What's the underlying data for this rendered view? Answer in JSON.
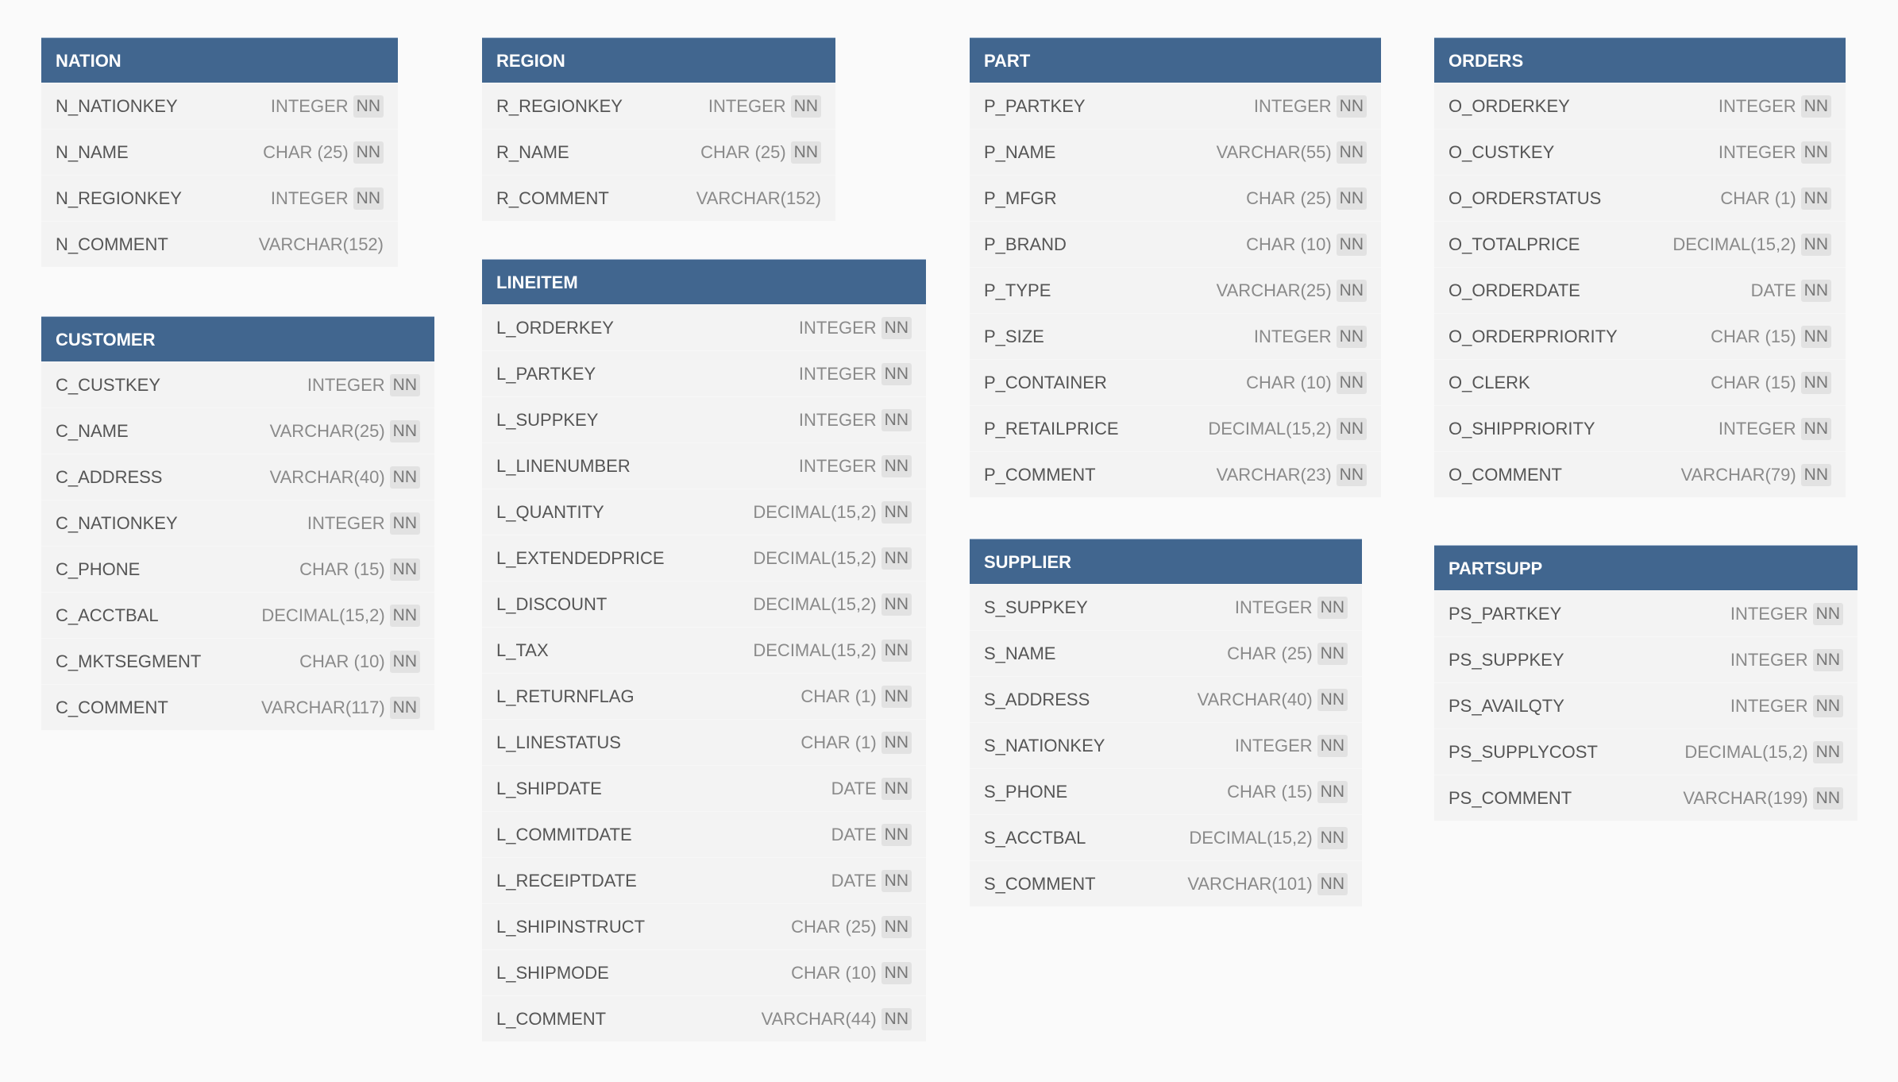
{
  "colors": {
    "header": "#41668f",
    "body": "#f3f3f3",
    "background": "#fafafa",
    "badge": "#e2e2e2"
  },
  "tables": [
    {
      "id": "nation",
      "name": "NATION",
      "columns": [
        {
          "name": "N_NATIONKEY",
          "type": "INTEGER",
          "nn": "NN"
        },
        {
          "name": "N_NAME",
          "type": "CHAR (25)",
          "nn": "NN"
        },
        {
          "name": "N_REGIONKEY",
          "type": "INTEGER",
          "nn": "NN"
        },
        {
          "name": "N_COMMENT",
          "type": "VARCHAR(152)",
          "nn": ""
        }
      ]
    },
    {
      "id": "region",
      "name": "REGION",
      "columns": [
        {
          "name": "R_REGIONKEY",
          "type": "INTEGER",
          "nn": "NN"
        },
        {
          "name": "R_NAME",
          "type": "CHAR (25)",
          "nn": "NN"
        },
        {
          "name": "R_COMMENT",
          "type": "VARCHAR(152)",
          "nn": ""
        }
      ]
    },
    {
      "id": "lineitem",
      "name": "LINEITEM",
      "columns": [
        {
          "name": "L_ORDERKEY",
          "type": "INTEGER",
          "nn": "NN"
        },
        {
          "name": "L_PARTKEY",
          "type": "INTEGER",
          "nn": "NN"
        },
        {
          "name": "L_SUPPKEY",
          "type": "INTEGER",
          "nn": "NN"
        },
        {
          "name": "L_LINENUMBER",
          "type": "INTEGER",
          "nn": "NN"
        },
        {
          "name": "L_QUANTITY",
          "type": "DECIMAL(15,2)",
          "nn": "NN"
        },
        {
          "name": "L_EXTENDEDPRICE",
          "type": "DECIMAL(15,2)",
          "nn": "NN"
        },
        {
          "name": "L_DISCOUNT",
          "type": "DECIMAL(15,2)",
          "nn": "NN"
        },
        {
          "name": "L_TAX",
          "type": "DECIMAL(15,2)",
          "nn": "NN"
        },
        {
          "name": "L_RETURNFLAG",
          "type": "CHAR (1)",
          "nn": "NN"
        },
        {
          "name": "L_LINESTATUS",
          "type": "CHAR (1)",
          "nn": "NN"
        },
        {
          "name": "L_SHIPDATE",
          "type": "DATE",
          "nn": "NN"
        },
        {
          "name": "L_COMMITDATE",
          "type": "DATE",
          "nn": "NN"
        },
        {
          "name": "L_RECEIPTDATE",
          "type": "DATE",
          "nn": "NN"
        },
        {
          "name": "L_SHIPINSTRUCT",
          "type": "CHAR (25)",
          "nn": "NN"
        },
        {
          "name": "L_SHIPMODE",
          "type": "CHAR (10)",
          "nn": "NN"
        },
        {
          "name": "L_COMMENT",
          "type": "VARCHAR(44)",
          "nn": "NN"
        }
      ]
    },
    {
      "id": "customer",
      "name": "CUSTOMER",
      "columns": [
        {
          "name": "C_CUSTKEY",
          "type": "INTEGER",
          "nn": "NN"
        },
        {
          "name": "C_NAME",
          "type": "VARCHAR(25)",
          "nn": "NN"
        },
        {
          "name": "C_ADDRESS",
          "type": "VARCHAR(40)",
          "nn": "NN"
        },
        {
          "name": "C_NATIONKEY",
          "type": "INTEGER",
          "nn": "NN"
        },
        {
          "name": "C_PHONE",
          "type": "CHAR (15)",
          "nn": "NN"
        },
        {
          "name": "C_ACCTBAL",
          "type": "DECIMAL(15,2)",
          "nn": "NN"
        },
        {
          "name": "C_MKTSEGMENT",
          "type": "CHAR (10)",
          "nn": "NN"
        },
        {
          "name": "C_COMMENT",
          "type": "VARCHAR(117)",
          "nn": "NN"
        }
      ]
    },
    {
      "id": "part",
      "name": "PART",
      "columns": [
        {
          "name": "P_PARTKEY",
          "type": "INTEGER",
          "nn": "NN"
        },
        {
          "name": "P_NAME",
          "type": "VARCHAR(55)",
          "nn": "NN"
        },
        {
          "name": "P_MFGR",
          "type": "CHAR (25)",
          "nn": "NN"
        },
        {
          "name": "P_BRAND",
          "type": "CHAR (10)",
          "nn": "NN"
        },
        {
          "name": "P_TYPE",
          "type": "VARCHAR(25)",
          "nn": "NN"
        },
        {
          "name": "P_SIZE",
          "type": "INTEGER",
          "nn": "NN"
        },
        {
          "name": "P_CONTAINER",
          "type": "CHAR (10)",
          "nn": "NN"
        },
        {
          "name": "P_RETAILPRICE",
          "type": "DECIMAL(15,2)",
          "nn": "NN"
        },
        {
          "name": "P_COMMENT",
          "type": "VARCHAR(23)",
          "nn": "NN"
        }
      ]
    },
    {
      "id": "supplier",
      "name": "SUPPLIER",
      "columns": [
        {
          "name": "S_SUPPKEY",
          "type": "INTEGER",
          "nn": "NN"
        },
        {
          "name": "S_NAME",
          "type": "CHAR (25)",
          "nn": "NN"
        },
        {
          "name": "S_ADDRESS",
          "type": "VARCHAR(40)",
          "nn": "NN"
        },
        {
          "name": "S_NATIONKEY",
          "type": "INTEGER",
          "nn": "NN"
        },
        {
          "name": "S_PHONE",
          "type": "CHAR (15)",
          "nn": "NN"
        },
        {
          "name": "S_ACCTBAL",
          "type": "DECIMAL(15,2)",
          "nn": "NN"
        },
        {
          "name": "S_COMMENT",
          "type": "VARCHAR(101)",
          "nn": "NN"
        }
      ]
    },
    {
      "id": "orders",
      "name": "ORDERS",
      "columns": [
        {
          "name": "O_ORDERKEY",
          "type": "INTEGER",
          "nn": "NN"
        },
        {
          "name": "O_CUSTKEY",
          "type": "INTEGER",
          "nn": "NN"
        },
        {
          "name": "O_ORDERSTATUS",
          "type": "CHAR (1)",
          "nn": "NN"
        },
        {
          "name": "O_TOTALPRICE",
          "type": "DECIMAL(15,2)",
          "nn": "NN"
        },
        {
          "name": "O_ORDERDATE",
          "type": "DATE",
          "nn": "NN"
        },
        {
          "name": "O_ORDERPRIORITY",
          "type": "CHAR (15)",
          "nn": "NN"
        },
        {
          "name": "O_CLERK",
          "type": "CHAR (15)",
          "nn": "NN"
        },
        {
          "name": "O_SHIPPRIORITY",
          "type": "INTEGER",
          "nn": "NN"
        },
        {
          "name": "O_COMMENT",
          "type": "VARCHAR(79)",
          "nn": "NN"
        }
      ]
    },
    {
      "id": "partsupp",
      "name": "PARTSUPP",
      "columns": [
        {
          "name": "PS_PARTKEY",
          "type": "INTEGER",
          "nn": "NN"
        },
        {
          "name": "PS_SUPPKEY",
          "type": "INTEGER",
          "nn": "NN"
        },
        {
          "name": "PS_AVAILQTY",
          "type": "INTEGER",
          "nn": "NN"
        },
        {
          "name": "PS_SUPPLYCOST",
          "type": "DECIMAL(15,2)",
          "nn": "NN"
        },
        {
          "name": "PS_COMMENT",
          "type": "VARCHAR(199)",
          "nn": "NN"
        }
      ]
    }
  ]
}
